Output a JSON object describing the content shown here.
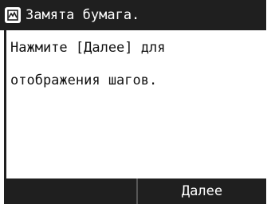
{
  "titlebar": {
    "icon": "paper-jam-icon",
    "title": "Замята бумага."
  },
  "message": {
    "line1": "Нажмите [Далее] для",
    "line2": "отображения шагов."
  },
  "softkeys": {
    "left_label": "",
    "right_label": "Далее"
  },
  "colors": {
    "bar": "#1f1f1f",
    "text_on_bar": "#ffffff",
    "body_text": "#111111"
  }
}
